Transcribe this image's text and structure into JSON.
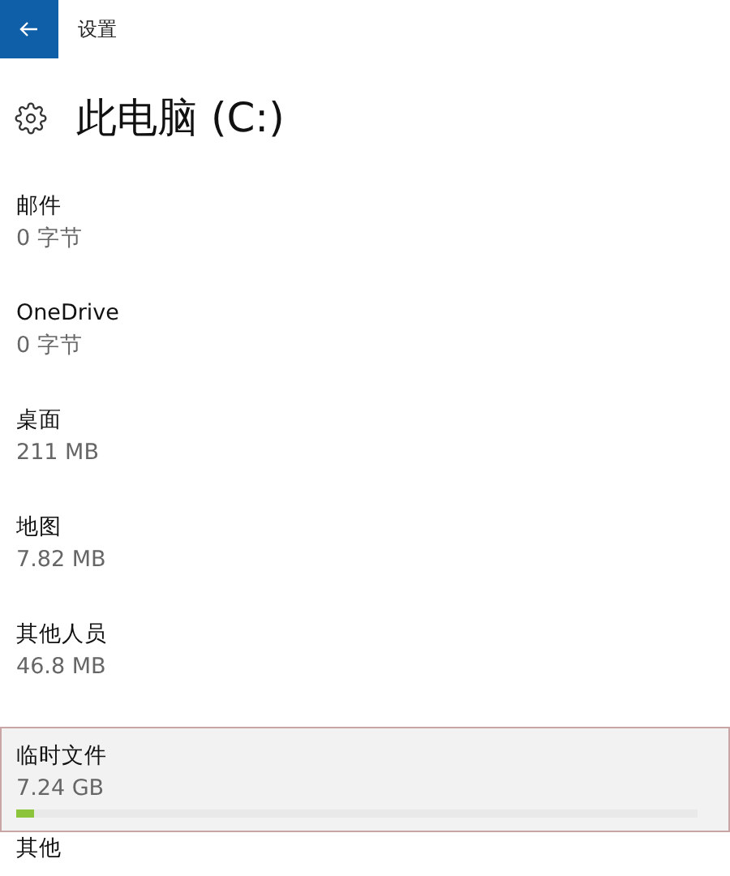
{
  "window": {
    "title": "设置"
  },
  "heading": "此电脑 (C:)",
  "items": [
    {
      "name": "邮件",
      "size": "0 字节",
      "selected": false
    },
    {
      "name": "OneDrive",
      "size": "0 字节",
      "selected": false
    },
    {
      "name": "桌面",
      "size": "211 MB",
      "selected": false
    },
    {
      "name": "地图",
      "size": "7.82 MB",
      "selected": false
    },
    {
      "name": "其他人员",
      "size": "46.8 MB",
      "selected": false
    },
    {
      "name": "临时文件",
      "size": "7.24 GB",
      "selected": true,
      "level": 0.025
    },
    {
      "name": "其他",
      "selected": false
    }
  ]
}
